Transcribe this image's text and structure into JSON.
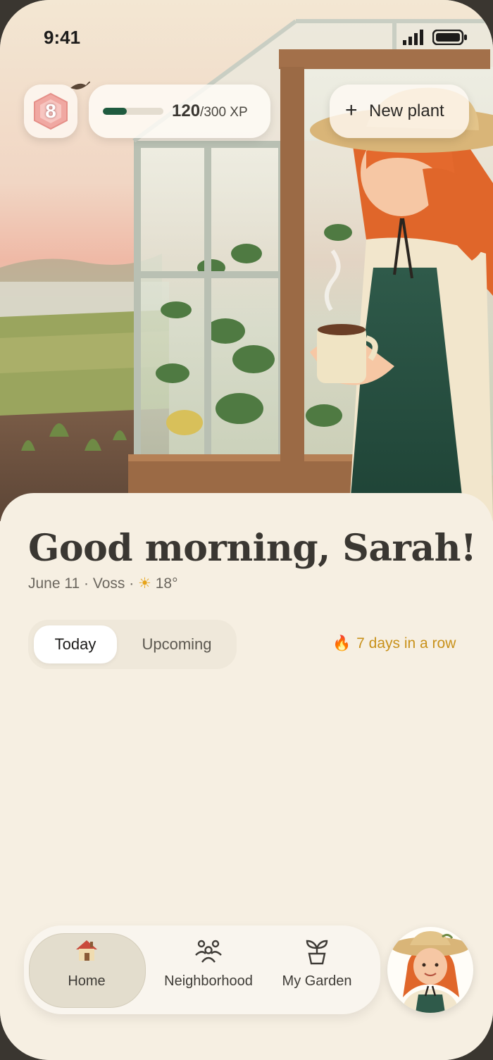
{
  "status": {
    "time": "9:41"
  },
  "header": {
    "level": "8",
    "xp_current": "120",
    "xp_total": "/300 XP",
    "xp_progress": 0.4,
    "new_plant_label": "New plant"
  },
  "greeting": {
    "title": "Good morning, Sarah!",
    "date": "June 11",
    "location": "Voss",
    "temperature": "18°"
  },
  "tabs": [
    {
      "label": "Today",
      "active": true
    },
    {
      "label": "Upcoming",
      "active": false
    }
  ],
  "streak": {
    "label": "7 days in a row"
  },
  "nav": [
    {
      "label": "Home",
      "icon": "house-icon",
      "active": true
    },
    {
      "label": "Neighborhood",
      "icon": "people-icon",
      "active": false
    },
    {
      "label": "My Garden",
      "icon": "plant-icon",
      "active": false
    }
  ],
  "colors": {
    "background": "#f6efe2",
    "accent_green": "#1f5b3f",
    "streak": "#c8911a",
    "text": "#3a3732"
  }
}
